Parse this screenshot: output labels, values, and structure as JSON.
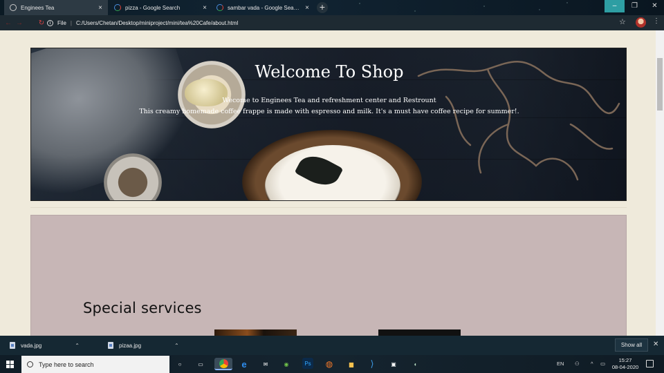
{
  "browser": {
    "tabs": [
      {
        "label": "Enginees Tea",
        "close": "×"
      },
      {
        "label": "pizza - Google Search",
        "close": "×"
      },
      {
        "label": "sambar vada - Google Search",
        "close": "×"
      }
    ],
    "new_tab": "+",
    "window": {
      "minimize": "–",
      "maximize": "❐",
      "close": "✕"
    },
    "url_scheme_label": "File",
    "url": "C:/Users/Chetan/Desktop/miniproject/mini/tea%20Cafe/about.html"
  },
  "hero": {
    "title": "Welcome To Shop",
    "line1": "Wecome to Enginees Tea and refreshment center and Restrount",
    "line2": "This creamy homemade coffee frappe is made with espresso and milk. It's a must have coffee recipe for summer!."
  },
  "services": {
    "title": "Special services"
  },
  "downloads": {
    "items": [
      {
        "name": "vada.jpg"
      },
      {
        "name": "pizaa.jpg"
      }
    ],
    "show_all": "Show all",
    "close": "✕"
  },
  "taskbar": {
    "search_placeholder": "Type here to search",
    "language": "EN",
    "time": "15:27",
    "date": "08-04-2020"
  },
  "colors": {
    "page_bg": "#efeadb",
    "services_bg": "#c7b6b6",
    "chrome_bg": "#1e2a32"
  }
}
